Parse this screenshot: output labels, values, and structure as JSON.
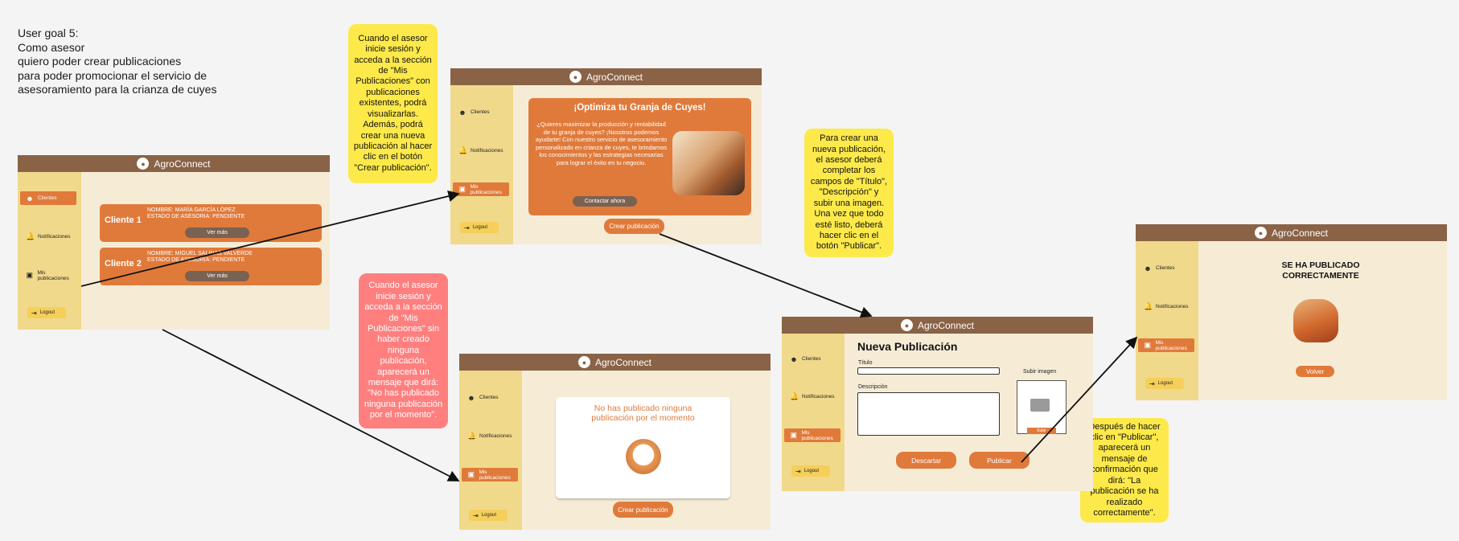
{
  "user_goal": {
    "lines": [
      "User goal 5:",
      "Como asesor",
      "quiero poder crear publicaciones",
      "para poder promocionar el servicio de",
      "asesoramiento para la crianza de cuyes"
    ]
  },
  "notes": {
    "with_publications": "Cuando el asesor inicie sesión y acceda a la sección de \"Mis Publicaciones\" con publicaciones existentes, podrá visualizarlas. Además, podrá crear una nueva publicación al hacer clic en el botón \"Crear publicación\".",
    "no_publications": "Cuando el asesor inicie sesión y acceda a la sección de \"Mis Publicaciones\" sin haber creado ninguna publicación, aparecerá un mensaje que dirá: \"No has publicado ninguna publicación por el momento\".",
    "create_publication": "Para crear una nueva publicación, el asesor deberá completar los campos de \"Título\", \"Descripción\" y subir una imagen. Una vez que todo esté listo, deberá hacer clic en el botón \"Publicar\".",
    "after_publish": "Después de hacer clic en \"Publicar\", aparecerá un mensaje de confirmación que dirá: \"La publicación se ha realizado correctamente\"."
  },
  "app": {
    "name": "AgroConnect",
    "nav": {
      "clients": "Clientes",
      "notifications": "Notificaciones",
      "publications": "Mis publicaciones",
      "logout": "Logout"
    }
  },
  "clients_screen": {
    "clients": [
      {
        "label": "Cliente 1",
        "name": "NOMBRE: MARÍA GARCÍA LÓPEZ",
        "status": "ESTADO DE ASESORIA: PENDIENTE",
        "button": "Ver más"
      },
      {
        "label": "Cliente 2",
        "name": "NOMBRE: MIGUEL SALINAS VALVERDE",
        "status": "ESTADO DE ASESORIA: PENDIENTE",
        "button": "Ver más"
      }
    ]
  },
  "publications_screen": {
    "post_title": "¡Optimiza tu Granja de Cuyes!",
    "post_body": "¿Quieres maximizar la producción y rentabilidad de tu granja de cuyes? ¡Nosotros podemos ayudarte! Con nuestro servicio de asesoramiento personalizado en crianza de cuyes, te brindamos los conocimientos y las estrategias necesarias para lograr el éxito en tu negocio.",
    "contact_button": "Contactar ahora",
    "create_button": "Crear publicación"
  },
  "empty_screen": {
    "message": "No has publicado ninguna publicación por el momento",
    "create_button": "Crear publicación"
  },
  "new_publication_screen": {
    "heading": "Nueva Publicación",
    "title_label": "Título",
    "description_label": "Descripción",
    "upload_label": "Subir imagen",
    "upload_button": "Subir",
    "discard_button": "Descartar",
    "publish_button": "Publicar"
  },
  "success_screen": {
    "message": "SE HA PUBLICADO CORRECTAMENTE",
    "back_button": "Volver"
  },
  "icons": {
    "logo": "cuy-logo-icon",
    "clients": "farmer-icon",
    "notifications": "bell-icon",
    "publications": "image-icon",
    "logout": "logout-icon"
  },
  "colors": {
    "topbar": "#8a6246",
    "sidebar": "#f0d98a",
    "content_bg": "#f6ecd6",
    "accent": "#e07a3b",
    "note_yellow": "#fde94a",
    "note_red": "#ff7f7f"
  }
}
